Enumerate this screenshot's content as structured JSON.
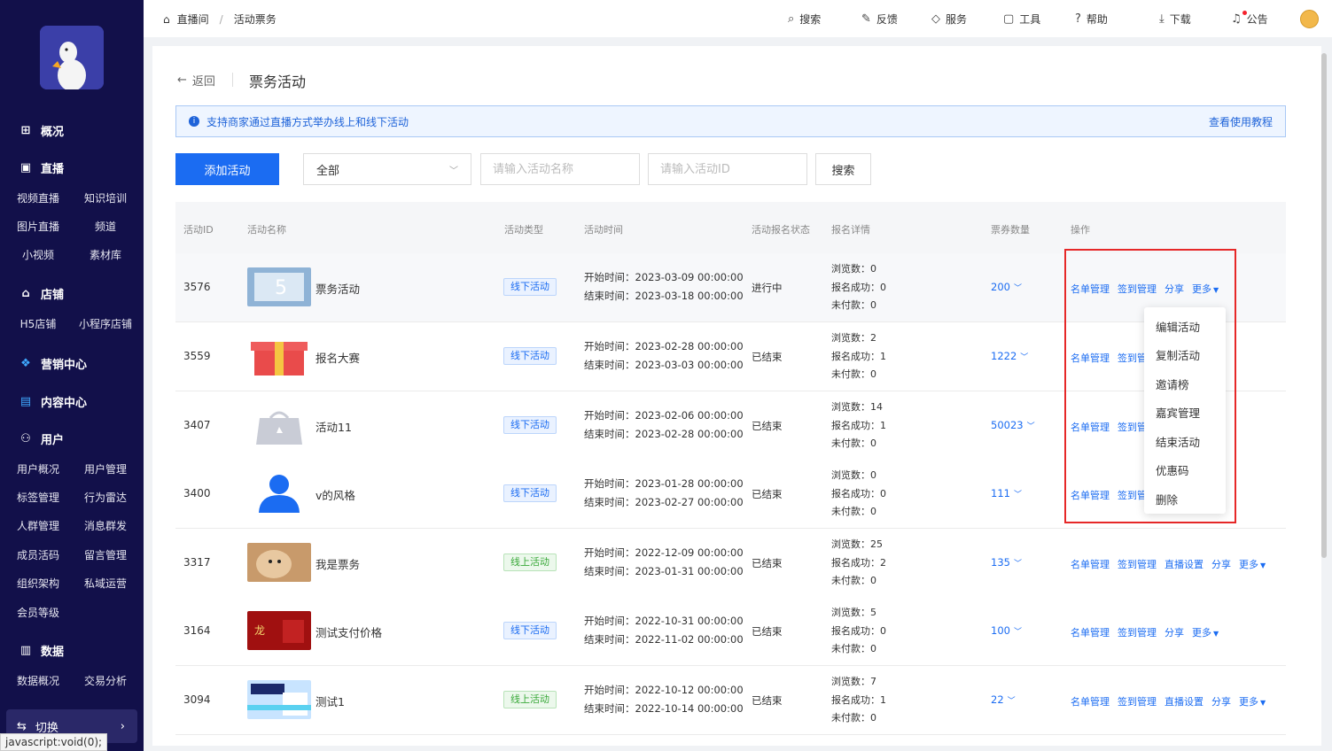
{
  "sidebar": {
    "sections": [
      {
        "label": "概况",
        "icon": "overview-icon"
      },
      {
        "label": "直播",
        "icon": "live-icon"
      },
      {
        "label": "店铺",
        "icon": "shop-icon"
      },
      {
        "label": "营销中心",
        "icon": "marketing-icon"
      },
      {
        "label": "内容中心",
        "icon": "content-icon"
      },
      {
        "label": "用户",
        "icon": "user-icon"
      },
      {
        "label": "数据",
        "icon": "data-icon"
      }
    ],
    "live_items": [
      "视频直播",
      "知识培训",
      "图片直播",
      "频道",
      "小视频",
      "素材库"
    ],
    "shop_items": [
      "H5店铺",
      "小程序店铺"
    ],
    "user_items": [
      "用户概况",
      "用户管理",
      "标签管理",
      "行为雷达",
      "人群管理",
      "消息群发",
      "成员活码",
      "留言管理",
      "组织架构",
      "私域运营",
      "会员等级"
    ],
    "data_items": [
      "数据概况",
      "交易分析"
    ],
    "switch_label": "切换",
    "status_text": "javascript:void(0);"
  },
  "header": {
    "breadcrumb": [
      "直播间",
      "活动票务"
    ],
    "nav": [
      {
        "label": "搜索",
        "icon": "search-icon"
      },
      {
        "label": "反馈",
        "icon": "edit-icon"
      },
      {
        "label": "服务",
        "icon": "diamond-icon"
      },
      {
        "label": "工具",
        "icon": "toolbox-icon"
      },
      {
        "label": "帮助",
        "icon": "help-icon"
      },
      {
        "label": "下载",
        "icon": "download-icon"
      },
      {
        "label": "公告",
        "icon": "bell-icon"
      }
    ]
  },
  "page": {
    "back_label": "返回",
    "title": "票务活动",
    "notice_text": "支持商家通过直播方式举办线上和线下活动",
    "notice_link": "查看使用教程",
    "add_button": "添加活动",
    "filter_select": "全部",
    "name_placeholder": "请输入活动名称",
    "id_placeholder": "请输入活动ID",
    "search_button": "搜索"
  },
  "table": {
    "headers": [
      "活动ID",
      "活动名称",
      "活动类型",
      "活动时间",
      "活动报名状态",
      "报名详情",
      "票券数量",
      "操作"
    ],
    "rows": [
      {
        "id": "3576",
        "name": "票务活动",
        "thumb": "banner",
        "type": "线下活动",
        "type_kind": "off",
        "start": "开始时间：2023-03-09 00:00:00",
        "end": "结束时间：2023-03-18 00:00:00",
        "status": "进行中",
        "views": "浏览数：0",
        "success": "报名成功：0",
        "unpaid": "未付款：0",
        "tickets": "200",
        "ops": [
          "名单管理",
          "签到管理",
          "分享",
          "更多"
        ]
      },
      {
        "id": "3559",
        "name": "报名大赛",
        "thumb": "gift",
        "type": "线下活动",
        "type_kind": "off",
        "start": "开始时间：2023-02-28 00:00:00",
        "end": "结束时间：2023-03-03 00:00:00",
        "status": "已结束",
        "views": "浏览数：2",
        "success": "报名成功：1",
        "unpaid": "未付款：0",
        "tickets": "1222",
        "ops": [
          "名单管理",
          "签到管"
        ]
      },
      {
        "id": "3407",
        "name": "活动11",
        "thumb": "bag",
        "type": "线下活动",
        "type_kind": "off",
        "start": "开始时间：2023-02-06 00:00:00",
        "end": "结束时间：2023-02-28 00:00:00",
        "status": "已结束",
        "views": "浏览数：14",
        "success": "报名成功：1",
        "unpaid": "未付款：0",
        "tickets": "50023",
        "ops": [
          "名单管理",
          "签到管"
        ]
      },
      {
        "id": "3400",
        "name": "v的风格",
        "thumb": "person",
        "type": "线下活动",
        "type_kind": "off",
        "start": "开始时间：2023-01-28 00:00:00",
        "end": "结束时间：2023-02-27 00:00:00",
        "status": "已结束",
        "views": "浏览数：0",
        "success": "报名成功：0",
        "unpaid": "未付款：0",
        "tickets": "111",
        "ops": [
          "名单管理",
          "签到管"
        ]
      },
      {
        "id": "3317",
        "name": "我是票务",
        "thumb": "dog",
        "type": "线上活动",
        "type_kind": "on",
        "start": "开始时间：2022-12-09 00:00:00",
        "end": "结束时间：2023-01-31 00:00:00",
        "status": "已结束",
        "views": "浏览数：25",
        "success": "报名成功：2",
        "unpaid": "未付款：0",
        "tickets": "135",
        "ops": [
          "名单管理",
          "签到管理",
          "直播设置",
          "分享",
          "更多"
        ]
      },
      {
        "id": "3164",
        "name": "测试支付价格",
        "thumb": "red",
        "type": "线下活动",
        "type_kind": "off",
        "start": "开始时间：2022-10-31 00:00:00",
        "end": "结束时间：2022-11-02 00:00:00",
        "status": "已结束",
        "views": "浏览数：5",
        "success": "报名成功：0",
        "unpaid": "未付款：0",
        "tickets": "100",
        "ops": [
          "名单管理",
          "签到管理",
          "分享",
          "更多"
        ]
      },
      {
        "id": "3094",
        "name": "测试1",
        "thumb": "game",
        "type": "线上活动",
        "type_kind": "on",
        "start": "开始时间：2022-10-12 00:00:00",
        "end": "结束时间：2022-10-14 00:00:00",
        "status": "已结束",
        "views": "浏览数：7",
        "success": "报名成功：1",
        "unpaid": "未付款：0",
        "tickets": "22",
        "ops": [
          "名单管理",
          "签到管理",
          "直播设置",
          "分享",
          "更多"
        ]
      }
    ]
  },
  "dropdown": {
    "items": [
      "编辑活动",
      "复制活动",
      "邀请榜",
      "嘉宾管理",
      "结束活动",
      "优惠码",
      "删除"
    ]
  },
  "colors": {
    "sidebar_bg": "#12104a",
    "primary": "#1b6cf2",
    "highlight_box": "#e62828"
  }
}
